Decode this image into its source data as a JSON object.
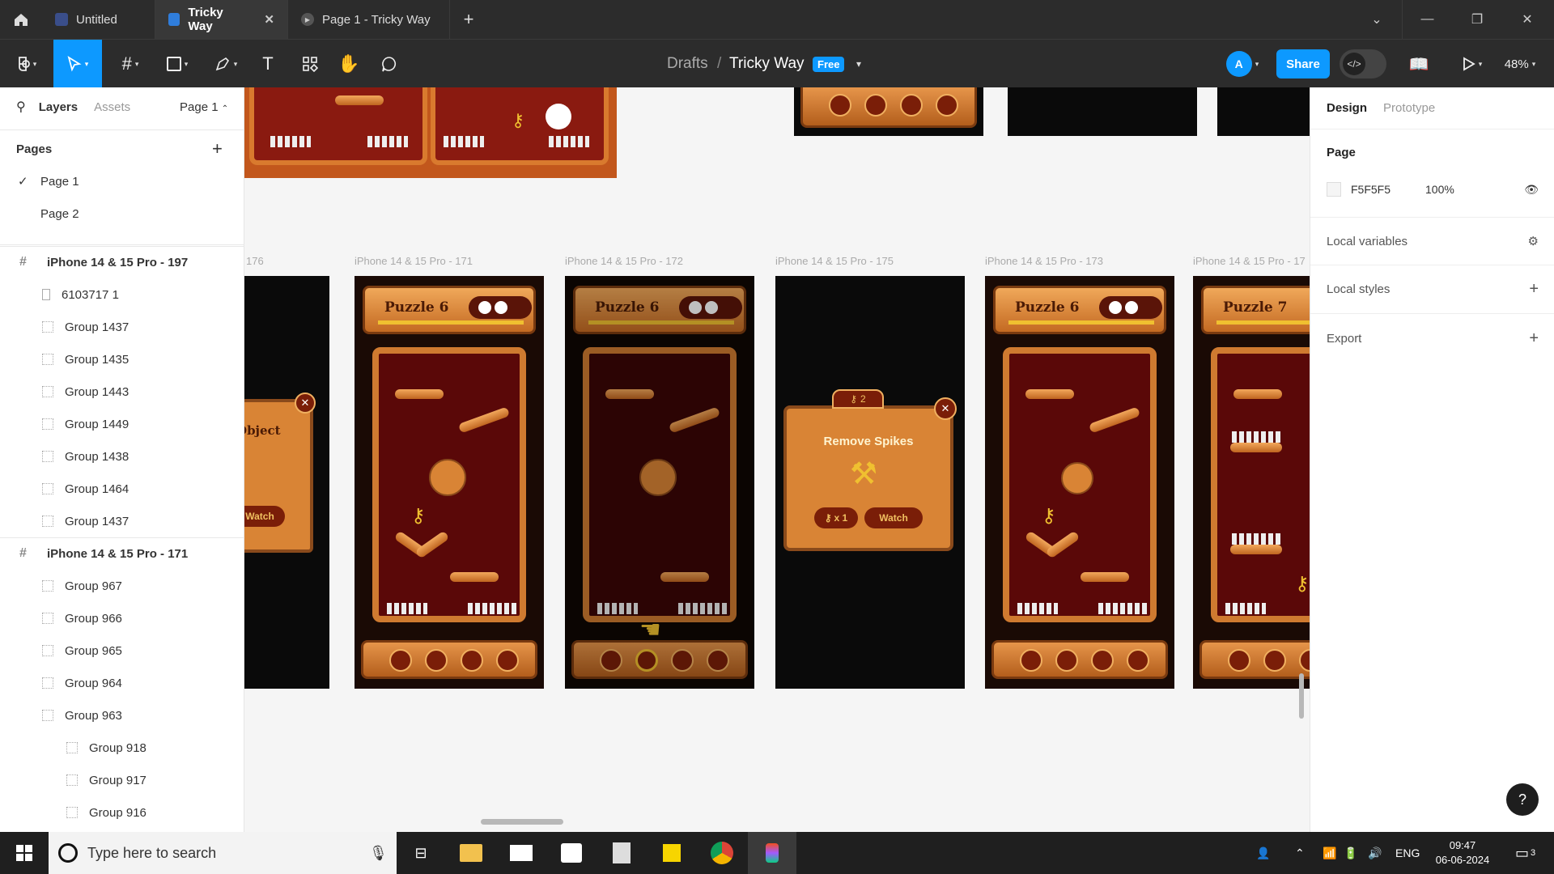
{
  "tabs": [
    {
      "label": "Untitled",
      "active": false
    },
    {
      "label": "Tricky Way",
      "active": true
    },
    {
      "label": "Page 1 - Tricky Way",
      "active": false
    }
  ],
  "toolbar": {
    "breadcrumb_root": "Drafts",
    "breadcrumb_sep": "/",
    "file_name": "Tricky Way",
    "plan_badge": "Free",
    "avatar_letter": "A",
    "share_label": "Share",
    "zoom": "48%"
  },
  "left_panel": {
    "tab_layers": "Layers",
    "tab_assets": "Assets",
    "page_selector": "Page 1",
    "pages_heading": "Pages",
    "pages": [
      "Page 1",
      "Page 2"
    ],
    "layers": [
      {
        "label": "iPhone 14 & 15 Pro - 197",
        "type": "frame"
      },
      {
        "label": "6103717 1",
        "type": "image"
      },
      {
        "label": "Group 1437",
        "type": "group"
      },
      {
        "label": "Group 1435",
        "type": "group"
      },
      {
        "label": "Group 1443",
        "type": "group"
      },
      {
        "label": "Group 1449",
        "type": "group"
      },
      {
        "label": "Group 1438",
        "type": "group"
      },
      {
        "label": "Group 1464",
        "type": "group"
      },
      {
        "label": "Group 1437",
        "type": "group"
      },
      {
        "label": "iPhone 14 & 15 Pro - 171",
        "type": "frame"
      },
      {
        "label": "Group 967",
        "type": "group"
      },
      {
        "label": "Group 966",
        "type": "group"
      },
      {
        "label": "Group 965",
        "type": "group"
      },
      {
        "label": "Group 964",
        "type": "group"
      },
      {
        "label": "Group 963",
        "type": "group"
      },
      {
        "label": "Group 918",
        "type": "subgroup"
      },
      {
        "label": "Group 917",
        "type": "subgroup"
      },
      {
        "label": "Group 916",
        "type": "subgroup"
      }
    ]
  },
  "right_panel": {
    "tab_design": "Design",
    "tab_prototype": "Prototype",
    "page_heading": "Page",
    "page_color": "F5F5F5",
    "page_opacity": "100%",
    "local_variables": "Local variables",
    "local_styles": "Local styles",
    "export": "Export"
  },
  "canvas": {
    "frame_labels": [
      "176",
      "iPhone 14 & 15 Pro - 171",
      "iPhone 14 & 15 Pro - 172",
      "iPhone 14 & 15 Pro - 175",
      "iPhone 14 & 15 Pro - 173",
      "iPhone 14 & 15 Pro - 17"
    ],
    "puzzle_titles": [
      "Puzzle 6",
      "Puzzle 6",
      "Puzzle 6",
      "Puzzle 7"
    ],
    "popup_title": "Remove Spikes",
    "popup_key_count": "2",
    "popup_cost": "x 1",
    "popup_watch": "Watch",
    "side_popup_title": "Object",
    "side_popup_watch": "Watch"
  },
  "taskbar": {
    "search_placeholder": "Type here to search",
    "language": "ENG",
    "time": "09:47",
    "date": "06-06-2024",
    "notifications": "3"
  },
  "colors": {
    "accent": "#0d99ff",
    "chrome_dark": "#2c2c2c",
    "canvas_bg": "#f5f5f5",
    "wood": "#e08a3a",
    "puzzle_bg": "#5a0808"
  }
}
